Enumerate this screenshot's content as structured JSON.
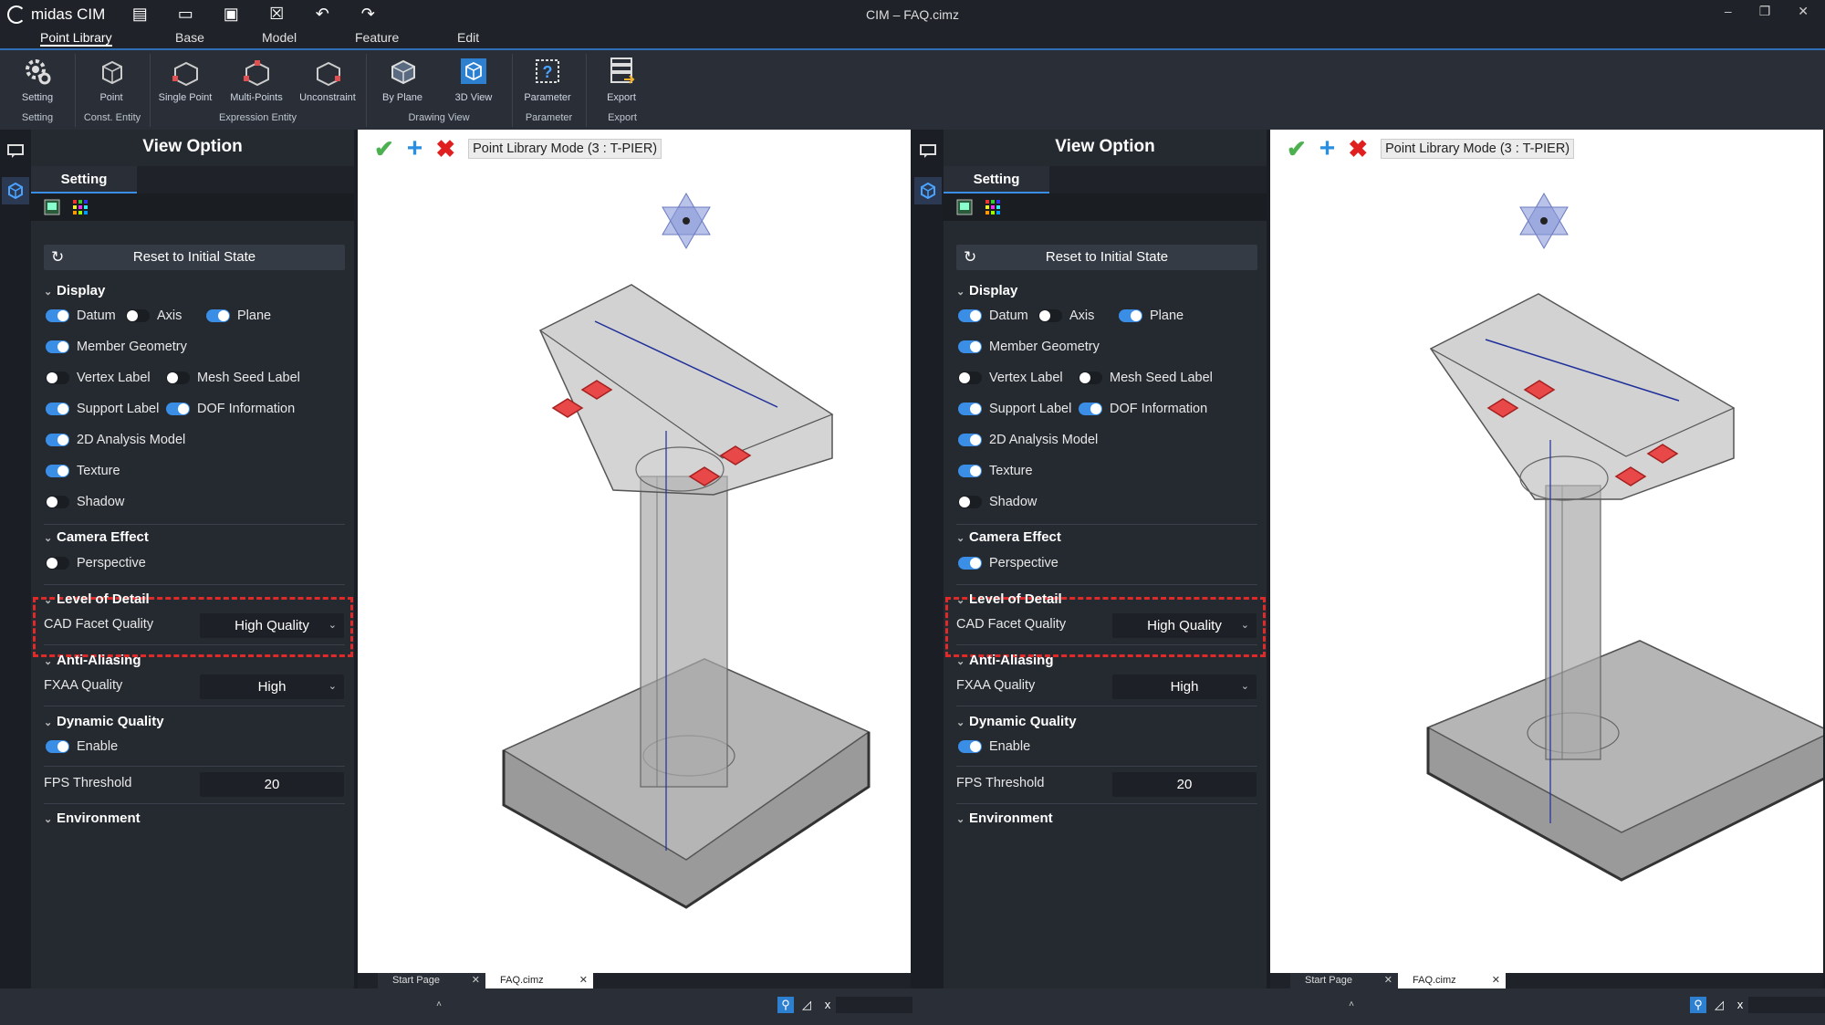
{
  "app": {
    "logo": "midas CIM",
    "title": "CIM – FAQ.cimz",
    "controls": [
      "–",
      "❐",
      "✕"
    ]
  },
  "quick_access": [
    "new-file-icon",
    "open-file-icon",
    "save-icon",
    "close-file-icon",
    "undo-icon",
    "redo-icon"
  ],
  "menu_tabs": [
    "Point Library",
    "Base",
    "Model",
    "Feature",
    "Edit"
  ],
  "ribbon": {
    "buttons": [
      "Setting",
      "Point",
      "Single Point",
      "Multi-Points",
      "Unconstraint",
      "By Plane",
      "3D View",
      "Parameter",
      "Export"
    ],
    "groups": [
      "Setting",
      "Const. Entity",
      "Expression Entity",
      "Drawing View",
      "Parameter",
      "Export"
    ]
  },
  "panels": [
    {
      "title": "View Option",
      "tab": "Setting",
      "reset": "Reset to Initial State",
      "display": {
        "heading": "Display",
        "datum": "Datum",
        "axis": "Axis",
        "plane": "Plane",
        "member_geometry": "Member Geometry",
        "vertex_label": "Vertex Label",
        "mesh_seed_label": "Mesh Seed Label",
        "support_label": "Support Label",
        "dof_information": "DOF Information",
        "analysis_2d": "2D Analysis Model",
        "texture": "Texture",
        "shadow": "Shadow"
      },
      "camera": {
        "heading": "Camera Effect",
        "perspective": "Perspective",
        "perspective_on": false
      },
      "lod": {
        "heading": "Level of Detail",
        "label": "CAD Facet Quality",
        "value": "High Quality"
      },
      "aa": {
        "heading": "Anti-Aliasing",
        "label": "FXAA Quality",
        "value": "High"
      },
      "dyn": {
        "heading": "Dynamic Quality",
        "enable": "Enable",
        "fps_label": "FPS Threshold",
        "fps": "20"
      },
      "env": {
        "heading": "Environment"
      },
      "mode": "Point Library Mode (3 : T-PIER)",
      "doc_tabs": [
        "Start Page",
        "FAQ.cimz"
      ]
    },
    {
      "title": "View Option",
      "tab": "Setting",
      "reset": "Reset to Initial State",
      "display": {
        "heading": "Display",
        "datum": "Datum",
        "axis": "Axis",
        "plane": "Plane",
        "member_geometry": "Member Geometry",
        "vertex_label": "Vertex Label",
        "mesh_seed_label": "Mesh Seed Label",
        "support_label": "Support Label",
        "dof_information": "DOF Information",
        "analysis_2d": "2D Analysis Model",
        "texture": "Texture",
        "shadow": "Shadow"
      },
      "camera": {
        "heading": "Camera Effect",
        "perspective": "Perspective",
        "perspective_on": true
      },
      "lod": {
        "heading": "Level of Detail",
        "label": "CAD Facet Quality",
        "value": "High Quality"
      },
      "aa": {
        "heading": "Anti-Aliasing",
        "label": "FXAA Quality",
        "value": "High"
      },
      "dyn": {
        "heading": "Dynamic Quality",
        "enable": "Enable",
        "fps_label": "FPS Threshold",
        "fps": "20"
      },
      "env": {
        "heading": "Environment"
      },
      "mode": "Point Library Mode (3 : T-PIER)",
      "doc_tabs": [
        "Start Page",
        "FAQ.cimz"
      ]
    }
  ],
  "colors": {
    "accent": "#3a8ee6",
    "highlight": "#e02a2a",
    "confirm": "#4caf50",
    "add": "#2a8fe0",
    "cancel": "#e02020"
  }
}
